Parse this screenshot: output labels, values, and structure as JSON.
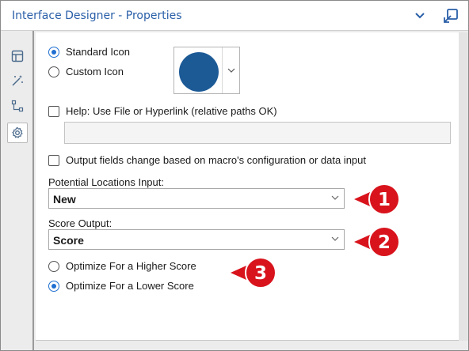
{
  "window": {
    "title": "Interface Designer - Properties"
  },
  "sidebar": {
    "items": [
      {
        "icon": "layout-icon"
      },
      {
        "icon": "magic-wand-icon"
      },
      {
        "icon": "tree-icon"
      },
      {
        "icon": "gear-icon",
        "active": true
      }
    ]
  },
  "icon_options": {
    "standard_label": "Standard Icon",
    "custom_label": "Custom Icon",
    "selected": "Standard Icon",
    "icon_color": "#1c5a96"
  },
  "help": {
    "label": "Help: Use File or Hyperlink (relative paths OK)",
    "checked": false,
    "value": ""
  },
  "output_fields": {
    "label": "Output fields change based on macro's configuration or data input",
    "checked": false
  },
  "potential_locations": {
    "label": "Potential Locations Input:",
    "value": "New"
  },
  "score_output": {
    "label": "Score Output:",
    "value": "Score"
  },
  "optimize": {
    "higher_label": "Optimize For a Higher Score",
    "lower_label": "Optimize For a Lower Score",
    "selected": "Optimize For a Lower Score"
  },
  "callouts": [
    "1",
    "2",
    "3"
  ],
  "colors": {
    "accent": "#1f6fd1",
    "callout_red": "#d8131c",
    "title_blue": "#2a5fa8"
  }
}
